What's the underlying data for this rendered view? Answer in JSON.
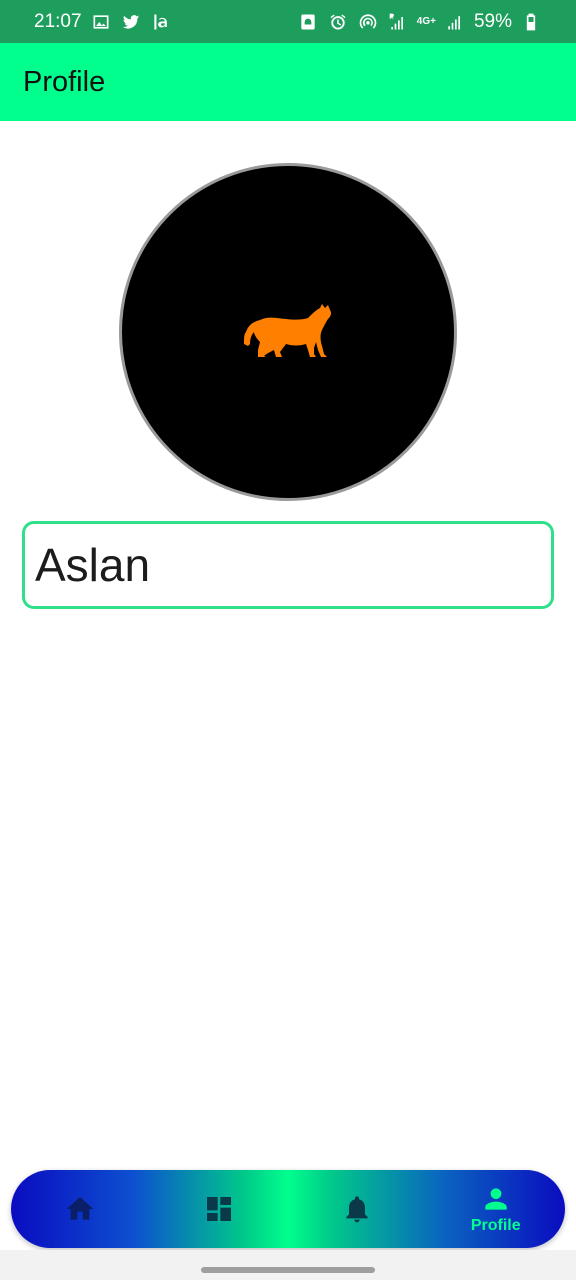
{
  "status_bar": {
    "time": "21:07",
    "network": "4G+",
    "battery": "59%",
    "icons": [
      "image-icon",
      "twitter-icon",
      "la-icon",
      "android-badge-icon",
      "alarm-icon",
      "hotspot-icon",
      "signal-r-icon",
      "signal-icon",
      "battery-icon"
    ]
  },
  "app_bar": {
    "title": "Profile"
  },
  "profile": {
    "avatar_icon": "tiger-icon",
    "avatar_color": "#ff7f00",
    "name_value": "Aslan"
  },
  "bottom_nav": {
    "items": [
      {
        "icon": "home-icon",
        "label": "",
        "active": false
      },
      {
        "icon": "dashboard-icon",
        "label": "",
        "active": false
      },
      {
        "icon": "bell-icon",
        "label": "",
        "active": false
      },
      {
        "icon": "person-icon",
        "label": "Profile",
        "active": true
      }
    ],
    "active_color": "#00ff8c",
    "inactive_color": "#0a1f66"
  }
}
